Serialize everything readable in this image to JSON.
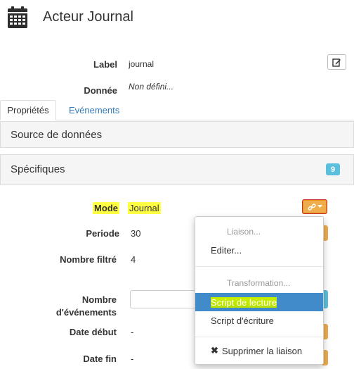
{
  "header": {
    "title": "Acteur Journal",
    "icon": "calendar-icon"
  },
  "fields": {
    "label_key": "Label",
    "label_val": "journal",
    "donnee_key": "Donnée",
    "donnee_val": "Non défini..."
  },
  "tabs": [
    {
      "label": "Propriétés"
    },
    {
      "label": "Evénements"
    }
  ],
  "panels": {
    "source": {
      "title": "Source de données"
    },
    "specifiques": {
      "title": "Spécifiques",
      "badge": "9"
    }
  },
  "props": {
    "mode_key": "Mode",
    "mode_val": "Journal",
    "periode_key": "Periode",
    "periode_val": "30",
    "filtre_key": "Nombre filtré",
    "filtre_val": "4",
    "nb_ev_key_1": "Nombre",
    "nb_ev_key_2": "d'événements",
    "date_debut_key": "Date début",
    "date_debut_val": "-",
    "date_fin_key": "Date fin",
    "date_fin_val": "-"
  },
  "dropdown": {
    "header_liaison": "Liaison...",
    "editer": "Editer...",
    "header_transformation": "Transformation...",
    "script_lecture": "Script de lecture",
    "script_ecriture": "Script d'écriture",
    "supprimer": "Supprimer la liaison"
  },
  "colors": {
    "accent": "#337ab7",
    "orange": "#f0ad4e",
    "info": "#5bc0de",
    "highlight": "#ffff44"
  }
}
